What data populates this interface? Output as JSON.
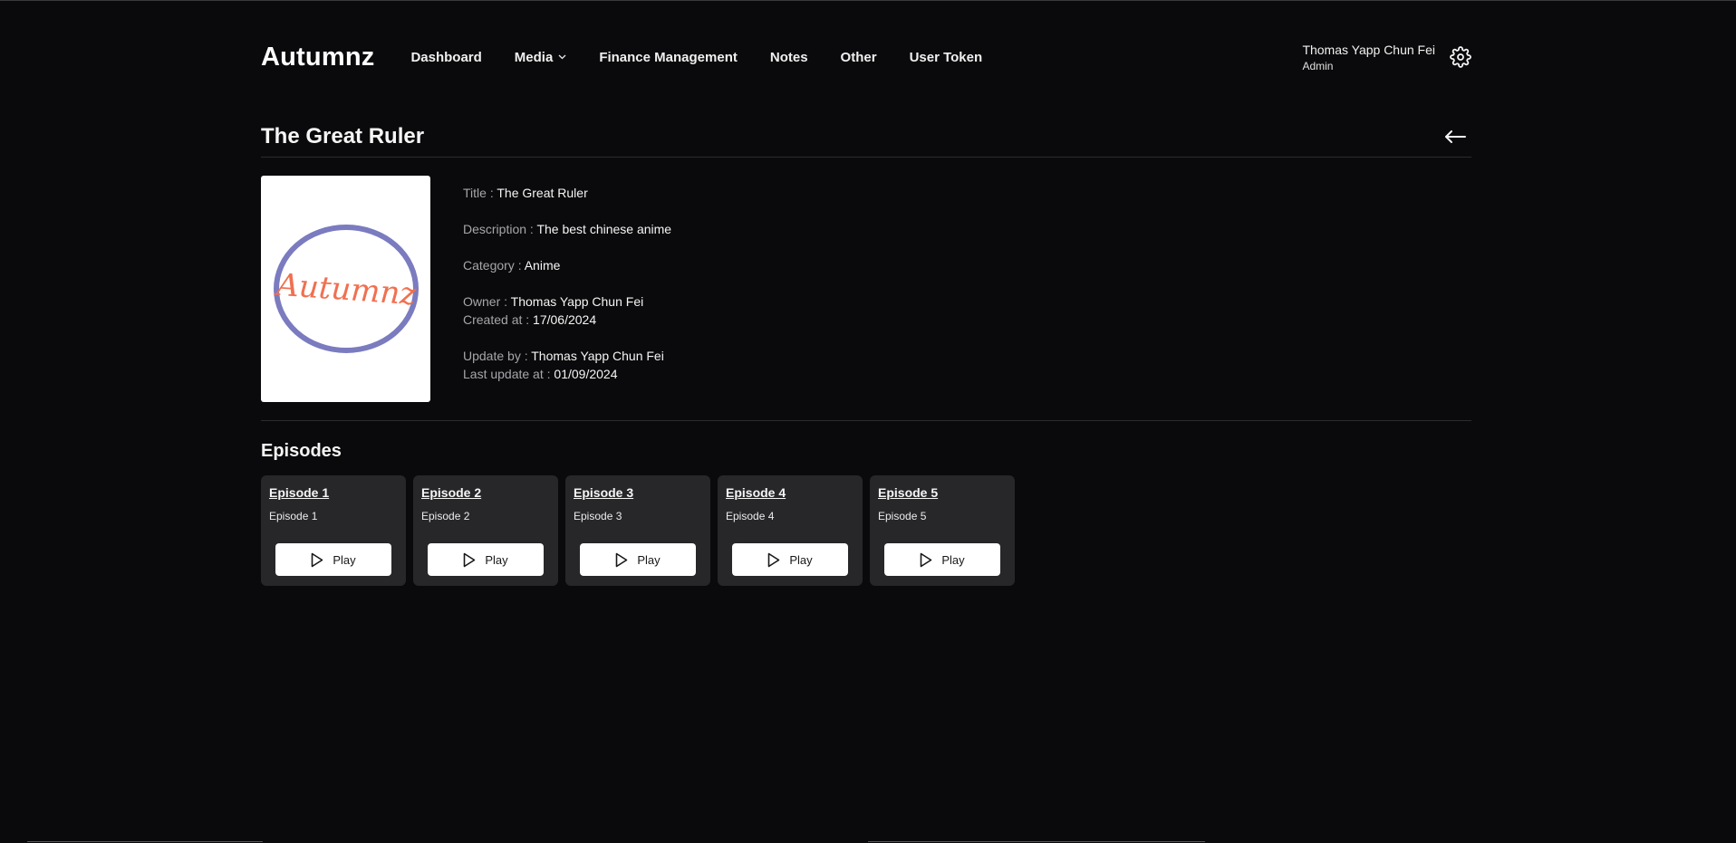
{
  "app": {
    "brand": "Autumnz"
  },
  "nav": {
    "items": [
      {
        "label": "Dashboard"
      },
      {
        "label": "Media",
        "has_dropdown": true
      },
      {
        "label": "Finance Management"
      },
      {
        "label": "Notes"
      },
      {
        "label": "Other"
      },
      {
        "label": "User Token"
      }
    ]
  },
  "user": {
    "name": "Thomas Yapp Chun Fei",
    "role": "Admin",
    "settings_icon": "gear-icon"
  },
  "page": {
    "title": "The Great Ruler",
    "back_icon": "arrow-left-icon"
  },
  "poster": {
    "logo_text": "Autumnz",
    "ring_color": "#7b7bc0",
    "text_color": "#f07050"
  },
  "details": {
    "title_label": "Title :",
    "title_value": "The Great Ruler",
    "description_label": "Description :",
    "description_value": "The best chinese anime",
    "category_label": "Category :",
    "category_value": "Anime",
    "owner_label": "Owner :",
    "owner_value": "Thomas Yapp Chun Fei",
    "created_label": "Created at :",
    "created_value": "17/06/2024",
    "updated_by_label": "Update by :",
    "updated_by_value": "Thomas Yapp Chun Fei",
    "last_update_label": "Last update at :",
    "last_update_value": "01/09/2024"
  },
  "episodes": {
    "heading": "Episodes",
    "items": [
      {
        "title": "Episode 1",
        "subtitle": "Episode 1",
        "play_label": "Play"
      },
      {
        "title": "Episode 2",
        "subtitle": "Episode 2",
        "play_label": "Play"
      },
      {
        "title": "Episode 3",
        "subtitle": "Episode 3",
        "play_label": "Play"
      },
      {
        "title": "Episode 4",
        "subtitle": "Episode 4",
        "play_label": "Play"
      },
      {
        "title": "Episode 5",
        "subtitle": "Episode 5",
        "play_label": "Play"
      }
    ]
  },
  "colors": {
    "background": "#0a0a0c",
    "card": "#27272a",
    "muted_text": "#a6a6ab"
  }
}
